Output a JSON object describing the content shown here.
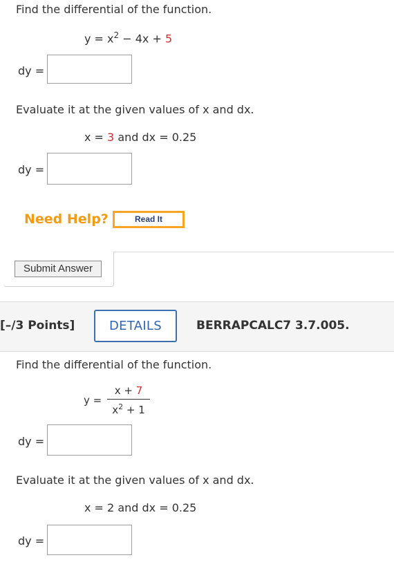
{
  "q1": {
    "prompt": "Find the differential of the function.",
    "equation": {
      "lhs": "y = x",
      "exp": "2",
      "minus": " − 4x + ",
      "const": "5"
    },
    "dy_label_1": "dy =",
    "evaluate_prompt": "Evaluate it at the given values of x and dx.",
    "given": {
      "x_label": "x = ",
      "x_value": "3",
      "and": " and dx = 0.25"
    },
    "dy_label_2": "dy =",
    "need_help": "Need Help?",
    "read_it": "Read It",
    "submit": "Submit Answer"
  },
  "q2": {
    "points": "[–/3 Points]",
    "details": "DETAILS",
    "code": "BERRAPCALC7 3.7.005.",
    "prompt": "Find the differential of the function.",
    "equation": {
      "lhs": "y =",
      "numerator_prefix": "x + ",
      "numerator_const": "7",
      "denominator_base": "x",
      "denominator_exp": "2",
      "denominator_rest": " + 1"
    },
    "dy_label_1": "dy =",
    "evaluate_prompt": "Evaluate it at the given values of x and dx.",
    "given": "x = 2 and dx = 0.25",
    "dy_label_2": "dy ="
  }
}
